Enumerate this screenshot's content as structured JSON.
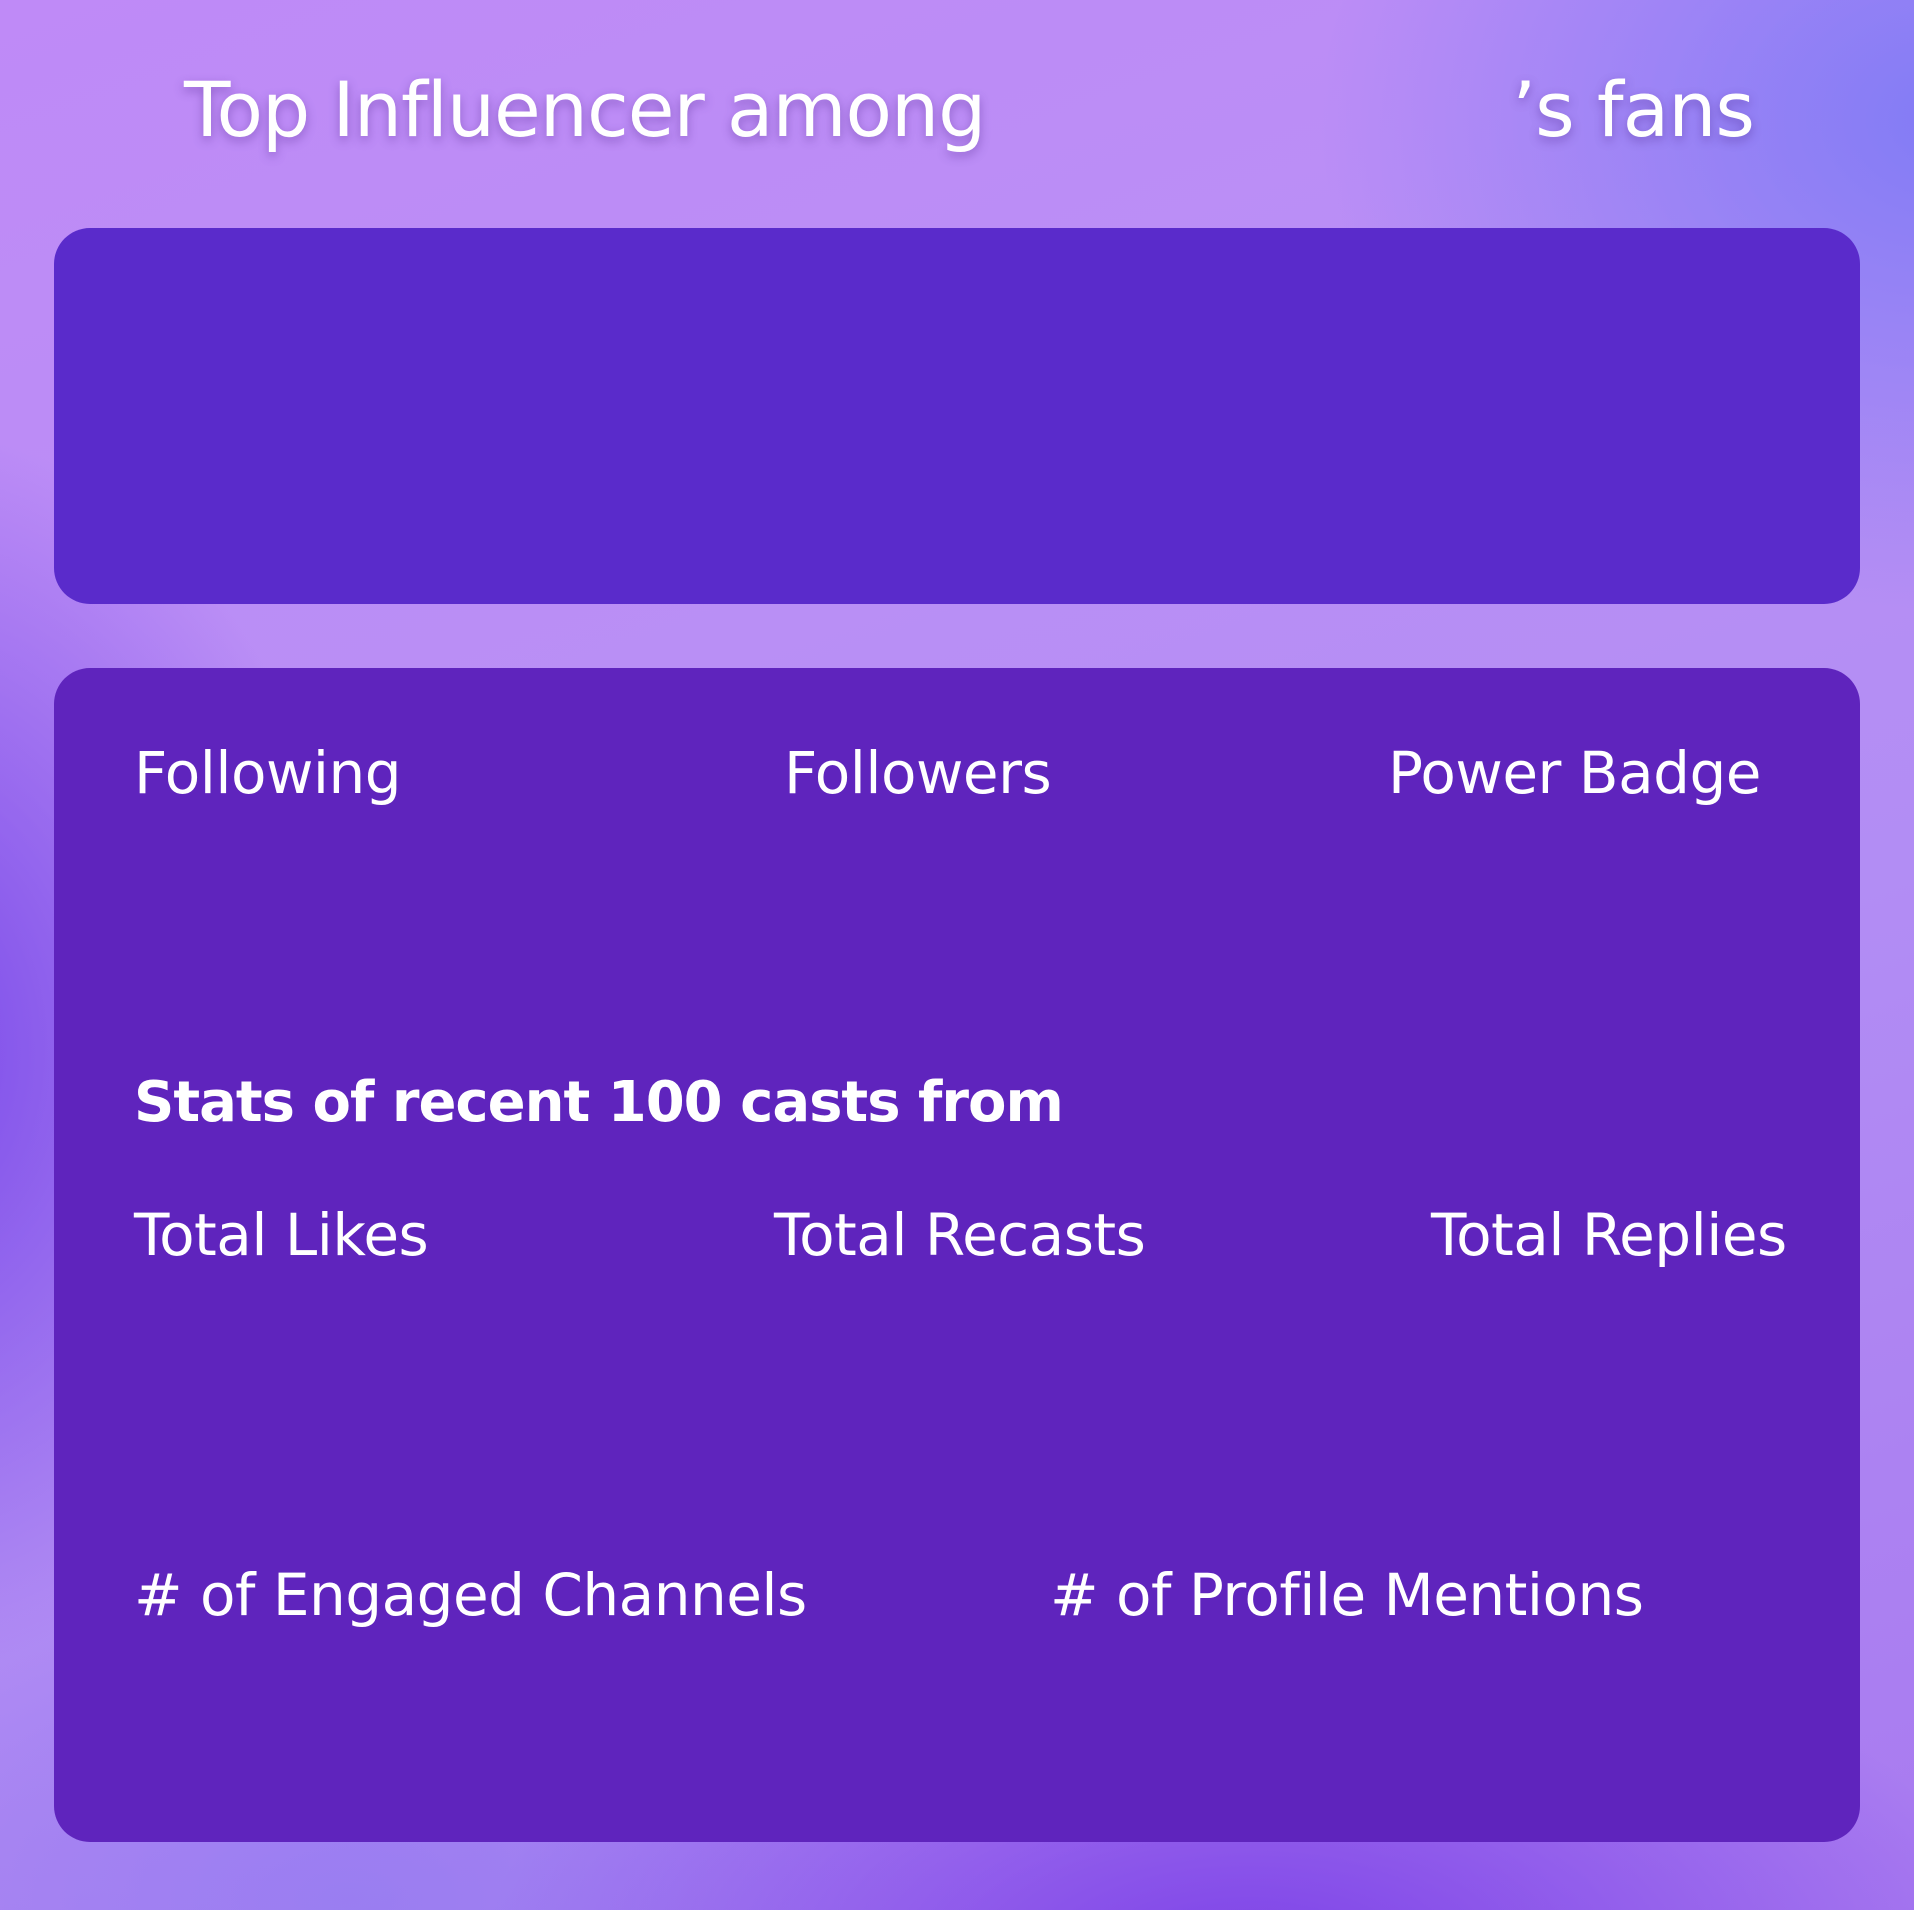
{
  "title": {
    "prefix": "Top Influencer among",
    "suffix": "’s fans"
  },
  "profile_stats": {
    "following_label": "Following",
    "followers_label": "Followers",
    "power_badge_label": "Power Badge"
  },
  "cast_stats": {
    "heading": "Stats of recent 100 casts from",
    "total_likes_label": "Total Likes",
    "total_recasts_label": "Total Recasts",
    "total_replies_label": "Total Replies",
    "engaged_channels_label": "# of Engaged Channels",
    "profile_mentions_label": "# of Profile Mentions"
  },
  "colors": {
    "top_panel": "#5a2bcb",
    "main_panel": "#5f24bd",
    "text": "#ffffff"
  }
}
